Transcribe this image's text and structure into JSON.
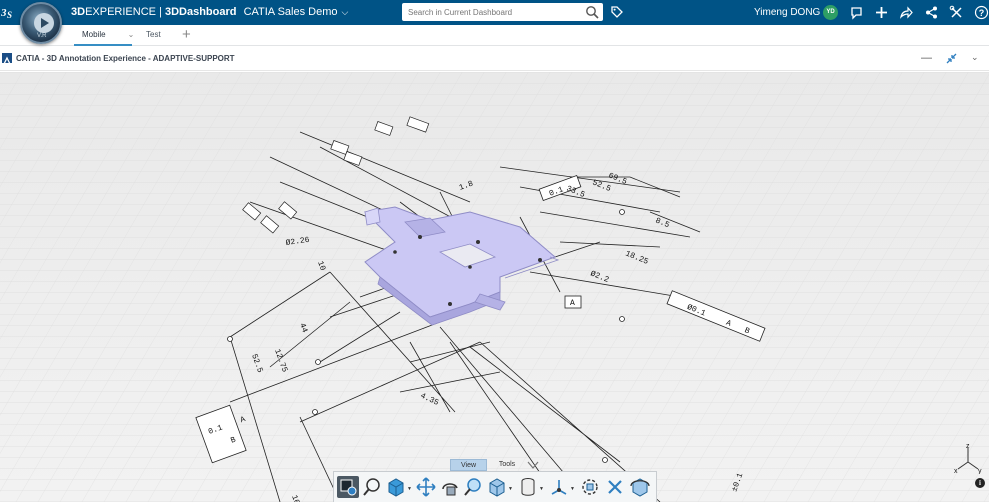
{
  "topbar": {
    "brand_bold": "3D",
    "brand_rest": "EXPERIENCE",
    "separator": " | ",
    "app_bold": "3D",
    "app_name": "Dashboard",
    "dashboard": "CATIA Sales Demo",
    "compass_version": "V.R",
    "search_placeholder": "Search in Current Dashboard",
    "user_name": "Yimeng DONG",
    "user_initials": "YD"
  },
  "tabs": [
    {
      "label": "Mobile",
      "active": true
    },
    {
      "label": "Test",
      "active": false
    }
  ],
  "widget": {
    "title": "CATIA - 3D Annotation Experience - ADAPTIVE-SUPPORT"
  },
  "annotations": {
    "dim_a": "69.5",
    "dim_b": "52.5",
    "dim_c": "33.5",
    "dim_d": "8.5",
    "dim_e": "18.25",
    "dim_f": "Ø2.2",
    "dim_g": "Ø2.26",
    "dim_h": "44",
    "dim_i": "12.75",
    "dim_j": "52.5",
    "dim_k": "4.35",
    "dim_l": "10",
    "tol": "±0.1",
    "tol_frame_1": "0.1",
    "tol_frame_2": "0.1",
    "datum_a": "A",
    "datum_b": "B",
    "right_tol": "±0.1",
    "bottom_left": "10",
    "top_center": "1.8",
    "fcf_phi": "Ø0.1",
    "fcf_mod": "A"
  },
  "bottom_tabs": [
    {
      "label": "View",
      "active": true
    },
    {
      "label": "Tools",
      "active": false
    }
  ],
  "toolbar_tools": [
    "display-mode",
    "zoom-fit",
    "view-selector",
    "pan",
    "rotate",
    "zoom-area",
    "shading",
    "section",
    "compass-toggle",
    "explode",
    "close-tool",
    "spin"
  ],
  "triad": {
    "x": "x",
    "y": "y",
    "z": "z"
  },
  "colors": {
    "topbar": "#005386",
    "accent": "#368ec4",
    "part": "#c8c6f2",
    "avatar": "#2e9e65"
  }
}
